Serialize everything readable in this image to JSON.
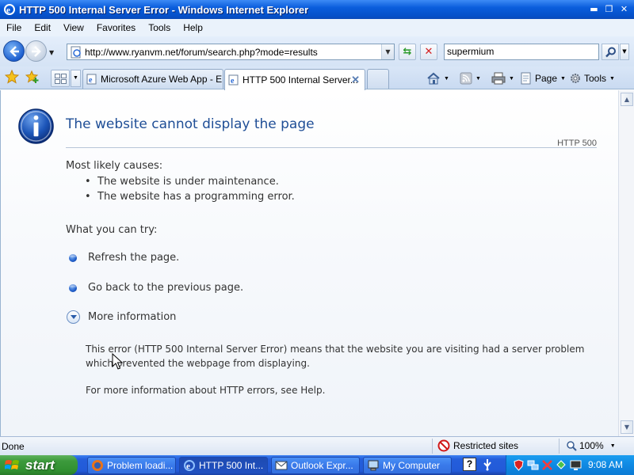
{
  "window": {
    "title": "HTTP 500 Internal Server Error - Windows Internet Explorer",
    "controls": [
      "minimize",
      "restore",
      "close"
    ]
  },
  "menu": {
    "items": [
      "File",
      "Edit",
      "View",
      "Favorites",
      "Tools",
      "Help"
    ]
  },
  "address": {
    "url": "http://www.ryanvm.net/forum/search.php?mode=results",
    "search_value": "supermium"
  },
  "tabs": [
    {
      "label": "Microsoft Azure Web App - E...",
      "active": false
    },
    {
      "label": "HTTP 500 Internal Server...",
      "active": true
    }
  ],
  "commands": {
    "page_label": "Page",
    "tools_label": "Tools"
  },
  "error_page": {
    "title": "The website cannot display the page",
    "code": "HTTP 500",
    "causes_heading": "Most likely causes:",
    "causes": [
      "The website is under maintenance.",
      "The website has a programming error."
    ],
    "try_heading": "What you can try:",
    "actions": [
      "Refresh the page.",
      "Go back to the previous page."
    ],
    "more_info": "More information",
    "detail": "This error (HTTP 500 Internal Server Error) means that the website you are visiting had a server problem which prevented the webpage from displaying.",
    "help": "For more information about HTTP errors, see Help."
  },
  "status": {
    "text": "Done",
    "zone": "Restricted sites",
    "zoom": "100%"
  },
  "taskbar": {
    "start_label": "start",
    "tasks": [
      "Problem loadi...",
      "HTTP 500 Int...",
      "Outlook Expr...",
      "My Computer"
    ],
    "help_label": "?",
    "clock": "9:08 AM"
  },
  "colors": {
    "title_blue": "#1f4e96",
    "xp_blue": "#245edb",
    "start_green": "#3c9a3c"
  }
}
